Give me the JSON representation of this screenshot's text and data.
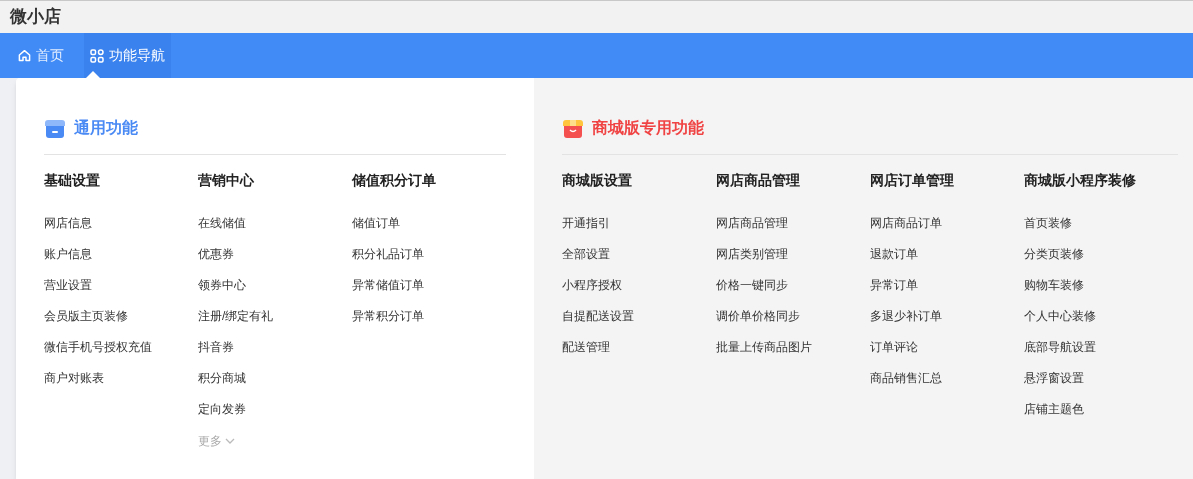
{
  "app_title": "微小店",
  "nav": [
    {
      "label": "首页",
      "kind": "home",
      "selected": false
    },
    {
      "label": "功能导航",
      "kind": "grid",
      "selected": true
    }
  ],
  "sections": [
    {
      "title": "通用功能",
      "kind": "general",
      "columns": [
        {
          "heading": "基础设置",
          "items": [
            "网店信息",
            "账户信息",
            "营业设置",
            "会员版主页装修",
            "微信手机号授权充值",
            "商户对账表"
          ]
        },
        {
          "heading": "营销中心",
          "items": [
            "在线储值",
            "优惠券",
            "领券中心",
            "注册/绑定有礼",
            "抖音券",
            "积分商城",
            "定向发券"
          ],
          "more": "更多"
        },
        {
          "heading": "储值积分订单",
          "items": [
            "储值订单",
            "积分礼品订单",
            "异常储值订单",
            "异常积分订单"
          ]
        }
      ]
    },
    {
      "title": "商城版专用功能",
      "kind": "mall",
      "columns": [
        {
          "heading": "商城版设置",
          "items": [
            "开通指引",
            "全部设置",
            "小程序授权",
            "自提配送设置",
            "配送管理"
          ]
        },
        {
          "heading": "网店商品管理",
          "items": [
            "网店商品管理",
            "网店类别管理",
            "价格一键同步",
            "调价单价格同步",
            "批量上传商品图片"
          ]
        },
        {
          "heading": "网店订单管理",
          "items": [
            "网店商品订单",
            "退款订单",
            "异常订单",
            "多退少补订单",
            "订单评论",
            "商品销售汇总"
          ]
        },
        {
          "heading": "商城版小程序装修",
          "items": [
            "首页装修",
            "分类页装修",
            "购物车装修",
            "个人中心装修",
            "底部导航设置",
            "悬浮窗设置",
            "店铺主题色"
          ]
        }
      ]
    }
  ]
}
